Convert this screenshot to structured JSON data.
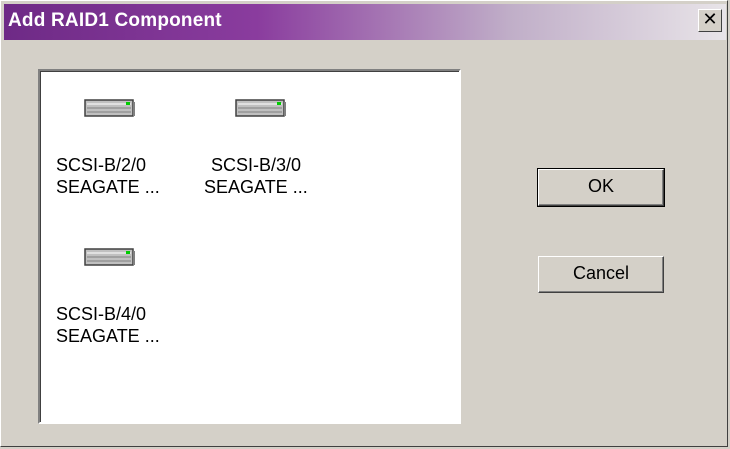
{
  "window": {
    "title": "Add RAID1 Component",
    "close_label": "✕"
  },
  "disks": [
    {
      "line1": "SCSI-B/2/0",
      "line2": "SEAGATE ..."
    },
    {
      "line1": "SCSI-B/3/0",
      "line2": "SEAGATE ..."
    },
    {
      "line1": "SCSI-B/4/0",
      "line2": "SEAGATE ..."
    }
  ],
  "buttons": {
    "ok": "OK",
    "cancel": "Cancel"
  }
}
